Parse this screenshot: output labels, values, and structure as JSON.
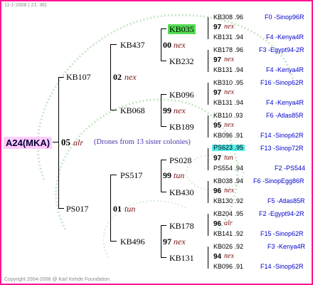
{
  "header": "11-1-2008 ( 21: 36)",
  "footer": "Copyright 2004-2008 @ Karl Kehde Foundation.",
  "root": {
    "label": "A24(MKA)",
    "year": "05",
    "year_suffix": "alr",
    "note": "(Drones from 13 sister colonies)"
  },
  "gen1": [
    {
      "label": "KB107",
      "year": "02",
      "suffix": "nex"
    },
    {
      "label": "PS017",
      "year": "01",
      "suffix": "tun"
    }
  ],
  "gen2": [
    {
      "label": "KB437",
      "year": "00",
      "suffix": "nex"
    },
    {
      "label": "KB068",
      "year": "99",
      "suffix": "nex"
    },
    {
      "label": "PS517",
      "year": "99",
      "suffix": "tun"
    },
    {
      "label": "KB496",
      "year": "97",
      "suffix": "nex"
    }
  ],
  "gen3": [
    {
      "label": "KB035"
    },
    {
      "label": "KB232"
    },
    {
      "label": "KB096"
    },
    {
      "label": "KB189"
    },
    {
      "label": "PS028"
    },
    {
      "label": "KB430"
    },
    {
      "label": "KB178"
    },
    {
      "label": "KB131"
    }
  ],
  "gen4": [
    {
      "top": "KB308 .96",
      "yr": "97",
      "sfx": "nex",
      "bot": "KB131 .94",
      "top_src": "F0 -Sinop96R",
      "bot_src": "F4 -Kenya4R"
    },
    {
      "top": "KB178 .96",
      "yr": "97",
      "sfx": "nex",
      "bot": "KB131 .94",
      "top_src": "F3 -Egypt94-2R",
      "bot_src": "F4 -Kenya4R"
    },
    {
      "top": "KB310 .95",
      "yr": "97",
      "sfx": "nex",
      "bot": "KB131 .94",
      "top_src": "F16 -Sinop62R",
      "bot_src": "F4 -Kenya4R"
    },
    {
      "top": "KB110 .93",
      "yr": "95",
      "sfx": "nex",
      "bot": "KB096 .91",
      "top_src": "F6 -Atlas85R",
      "bot_src": "F14 -Sinop62R"
    },
    {
      "top": "PS623 .95",
      "yr": "97",
      "sfx": "tun",
      "bot": "PS554 .94",
      "top_src": "F13 -Sinop72R",
      "bot_src": "F2 -PS544"
    },
    {
      "top": "KB038 .94",
      "yr": "96",
      "sfx": "nex",
      "bot": "KB130 .92",
      "top_src": "F6 -SinopEgg86R",
      "bot_src": "F5 -Atlas85R"
    },
    {
      "top": "KB204 .95",
      "yr": "96",
      "sfx": "alr",
      "bot": "KB141 .92",
      "top_src": "F2 -Egypt94-2R",
      "bot_src": "F15 -Sinop62R"
    },
    {
      "top": "KB026 .92",
      "yr": "94",
      "sfx": "nex",
      "bot": "KB096 .91",
      "top_src": "F3 -Kenya4R",
      "bot_src": "F14 -Sinop62R"
    }
  ]
}
